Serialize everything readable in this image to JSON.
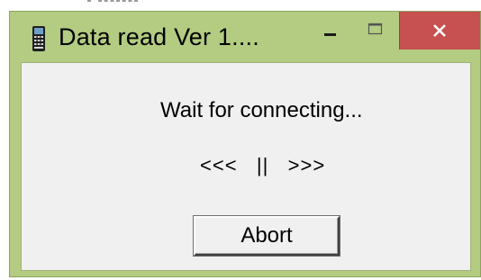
{
  "window": {
    "title": "Data read  Ver 1....",
    "controls": {
      "minimize_icon": "minimize-icon",
      "maximize_icon": "maximize-icon",
      "close_icon": "close-icon"
    },
    "app_icon": "handheld-terminal-icon"
  },
  "dialog": {
    "status_text": "Wait for connecting...",
    "progress_indicator": "<<<   ||   >>>",
    "abort_label": "Abort"
  },
  "colors": {
    "titlebar": "#b3cc82",
    "close_button": "#c75050",
    "client_bg": "#f0f0f0"
  }
}
